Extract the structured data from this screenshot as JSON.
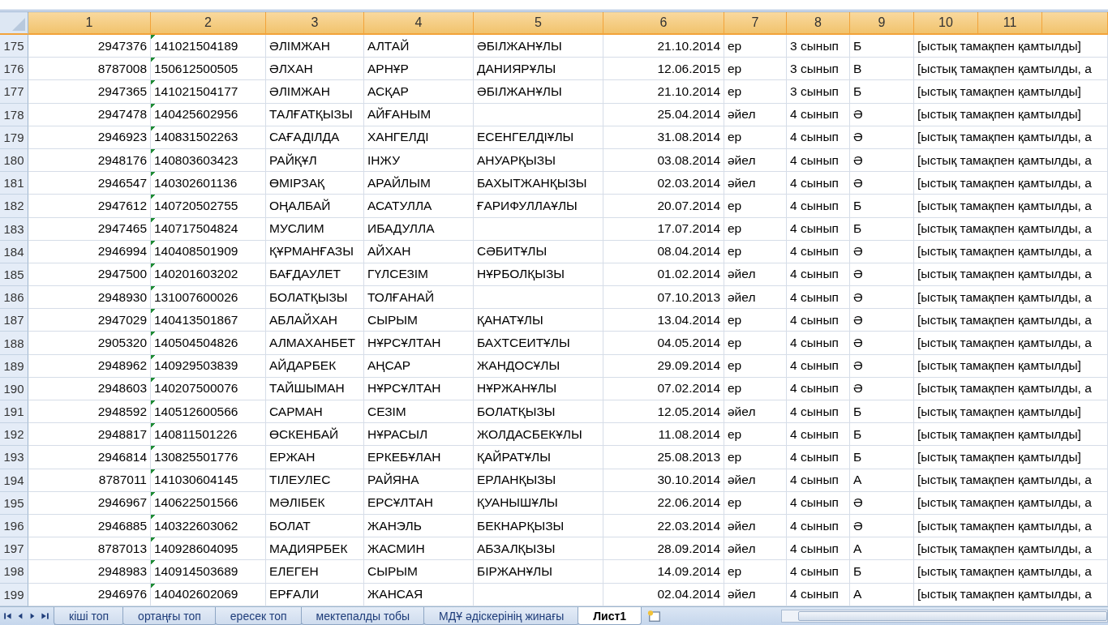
{
  "columns": [
    "1",
    "2",
    "3",
    "4",
    "5",
    "6",
    "7",
    "8",
    "9",
    "10",
    "11",
    null
  ],
  "rows": [
    {
      "row": "175",
      "cells": [
        "2947376",
        "141021504189",
        "ӘЛІМЖАН",
        "АЛТАЙ",
        "ӘБІЛЖАНҰЛЫ",
        "21.10.2014",
        "ер",
        "3 сынып",
        "Б",
        "[ыстық тамақпен қамтылды]"
      ]
    },
    {
      "row": "176",
      "cells": [
        "8787008",
        "150612500505",
        "ӘЛХАН",
        "АРНҰР",
        "ДАНИЯРҰЛЫ",
        "12.06.2015",
        "ер",
        "3 сынып",
        "В",
        "[ыстық тамақпен қамтылды, а"
      ]
    },
    {
      "row": "177",
      "cells": [
        "2947365",
        "141021504177",
        "ӘЛІМЖАН",
        "АСҚАР",
        "ӘБІЛЖАНҰЛЫ",
        "21.10.2014",
        "ер",
        "3 сынып",
        "Б",
        "[ыстық тамақпен қамтылды]"
      ]
    },
    {
      "row": "178",
      "cells": [
        "2947478",
        "140425602956",
        "ТАЛҒАТҚЫЗЫ",
        "АЙҒАНЫМ",
        null,
        "25.04.2014",
        "әйел",
        "4 сынып",
        "Ә",
        "[ыстық тамақпен қамтылды]"
      ]
    },
    {
      "row": "179",
      "cells": [
        "2946923",
        "140831502263",
        "САҒАДІЛДА",
        "ХАНГЕЛДІ",
        "ЕСЕНГЕЛДІҰЛЫ",
        "31.08.2014",
        "ер",
        "4 сынып",
        "Ә",
        "[ыстық тамақпен қамтылды, а"
      ]
    },
    {
      "row": "180",
      "cells": [
        "2948176",
        "140803603423",
        "РАЙҚҰЛ",
        "ІНЖУ",
        "АНУАРҚЫЗЫ",
        "03.08.2014",
        "әйел",
        "4 сынып",
        "Ә",
        "[ыстық тамақпен қамтылды, а"
      ]
    },
    {
      "row": "181",
      "cells": [
        "2946547",
        "140302601136",
        "ӨМІРЗАҚ",
        "АРАЙЛЫМ",
        "БАХЫТЖАНҚЫЗЫ",
        "02.03.2014",
        "әйел",
        "4 сынып",
        "Ә",
        "[ыстық тамақпен қамтылды, а"
      ]
    },
    {
      "row": "182",
      "cells": [
        "2947612",
        "140720502755",
        "ОҢАЛБАЙ",
        "АСАТУЛЛА",
        "ҒАРИФУЛЛАҰЛЫ",
        "20.07.2014",
        "ер",
        "4 сынып",
        "Б",
        "[ыстық тамақпен қамтылды, а"
      ]
    },
    {
      "row": "183",
      "cells": [
        "2947465",
        "140717504824",
        "МУСЛИМ",
        "ИБАДУЛЛА",
        null,
        "17.07.2014",
        "ер",
        "4 сынып",
        "Б",
        "[ыстық тамақпен қамтылды, а"
      ]
    },
    {
      "row": "184",
      "cells": [
        "2946994",
        "140408501909",
        "ҚҰРМАНҒАЗЫ",
        "АЙХАН",
        "СӘБИТҰЛЫ",
        "08.04.2014",
        "ер",
        "4 сынып",
        "Ә",
        "[ыстық тамақпен қамтылды, а"
      ]
    },
    {
      "row": "185",
      "cells": [
        "2947500",
        "140201603202",
        "БАҒДАУЛЕТ",
        "ГҮЛСЕЗІМ",
        "НҰРБОЛҚЫЗЫ",
        "01.02.2014",
        "әйел",
        "4 сынып",
        "Ә",
        "[ыстық тамақпен қамтылды, а"
      ]
    },
    {
      "row": "186",
      "cells": [
        "2948930",
        "131007600026",
        "БОЛАТҚЫЗЫ",
        "ТОЛҒАНАЙ",
        null,
        "07.10.2013",
        "әйел",
        "4 сынып",
        "Ә",
        "[ыстық тамақпен қамтылды, а"
      ]
    },
    {
      "row": "187",
      "cells": [
        "2947029",
        "140413501867",
        "АБЛАЙХАН",
        "СЫРЫМ",
        "ҚАНАТҰЛЫ",
        "13.04.2014",
        "ер",
        "4 сынып",
        "Ә",
        "[ыстық тамақпен қамтылды, а"
      ]
    },
    {
      "row": "188",
      "cells": [
        "2905320",
        "140504504826",
        "АЛМАХАНБЕТ",
        "НҰРСҰЛТАН",
        "БАХТСЕИТҰЛЫ",
        "04.05.2014",
        "ер",
        "4 сынып",
        "Ә",
        "[ыстық тамақпен қамтылды, а"
      ]
    },
    {
      "row": "189",
      "cells": [
        "2948962",
        "140929503839",
        "АЙДАРБЕК",
        "АҢСАР",
        "ЖАНДОСҰЛЫ",
        "29.09.2014",
        "ер",
        "4 сынып",
        "Ә",
        "[ыстық тамақпен қамтылды]"
      ]
    },
    {
      "row": "190",
      "cells": [
        "2948603",
        "140207500076",
        "ТАЙШЫМАН",
        "НҰРСҰЛТАН",
        "НҰРЖАНҰЛЫ",
        "07.02.2014",
        "ер",
        "4 сынып",
        "Ә",
        "[ыстық тамақпен қамтылды, а"
      ]
    },
    {
      "row": "191",
      "cells": [
        "2948592",
        "140512600566",
        "САРМАН",
        "СЕЗІМ",
        "БОЛАТҚЫЗЫ",
        "12.05.2014",
        "әйел",
        "4 сынып",
        "Б",
        "[ыстық тамақпен қамтылды]"
      ]
    },
    {
      "row": "192",
      "cells": [
        "2948817",
        "140811501226",
        "ӨСКЕНБАЙ",
        "НҰРАСЫЛ",
        "ЖОЛДАСБЕКҰЛЫ",
        "11.08.2014",
        "ер",
        "4 сынып",
        "Б",
        "[ыстық тамақпен қамтылды]"
      ]
    },
    {
      "row": "193",
      "cells": [
        "2946814",
        "130825501776",
        "ЕРЖАН",
        "ЕРКЕБҰЛАН",
        "ҚАЙРАТҰЛЫ",
        "25.08.2013",
        "ер",
        "4 сынып",
        "Б",
        "[ыстық тамақпен қамтылды]"
      ]
    },
    {
      "row": "194",
      "cells": [
        "8787011",
        "141030604145",
        "ТІЛЕУЛЕС",
        "РАЙЯНА",
        "ЕРЛАНҚЫЗЫ",
        "30.10.2014",
        "әйел",
        "4 сынып",
        "А",
        "[ыстық тамақпен қамтылды, а"
      ]
    },
    {
      "row": "195",
      "cells": [
        "2946967",
        "140622501566",
        "МӘЛІБЕК",
        "ЕРСҰЛТАН",
        "ҚУАНЫШҰЛЫ",
        "22.06.2014",
        "ер",
        "4 сынып",
        "Ә",
        "[ыстық тамақпен қамтылды, а"
      ]
    },
    {
      "row": "196",
      "cells": [
        "2946885",
        "140322603062",
        "БОЛАТ",
        "ЖАНЭЛЬ",
        "БЕКНАРҚЫЗЫ",
        "22.03.2014",
        "әйел",
        "4 сынып",
        "Ә",
        "[ыстық тамақпен қамтылды, а"
      ]
    },
    {
      "row": "197",
      "cells": [
        "8787013",
        "140928604095",
        "МАДИЯРБЕК",
        "ЖАСМИН",
        "АБЗАЛҚЫЗЫ",
        "28.09.2014",
        "әйел",
        "4 сынып",
        "А",
        "[ыстық тамақпен қамтылды, а"
      ]
    },
    {
      "row": "198",
      "cells": [
        "2948983",
        "140914503689",
        "ЕЛЕГЕН",
        "СЫРЫМ",
        "БІРЖАНҰЛЫ",
        "14.09.2014",
        "ер",
        "4 сынып",
        "Б",
        "[ыстық тамақпен қамтылды, а"
      ]
    },
    {
      "row": "199",
      "cells": [
        "2946976",
        "140402602069",
        "ЕРҒАЛИ",
        "ЖАНСАЯ",
        null,
        "02.04.2014",
        "әйел",
        "4 сынып",
        "А",
        "[ыстық тамақпен қамтылды, а"
      ]
    }
  ],
  "sheet_tabs": [
    {
      "label": "кіші топ",
      "selected": false
    },
    {
      "label": "ортаңғы топ",
      "selected": false
    },
    {
      "label": "ересек топ",
      "selected": false
    },
    {
      "label": "мектепалды тобы",
      "selected": false
    },
    {
      "label": "МДҰ әдіскерінің жинағы",
      "selected": false
    },
    {
      "label": "Лист1",
      "selected": true
    }
  ]
}
